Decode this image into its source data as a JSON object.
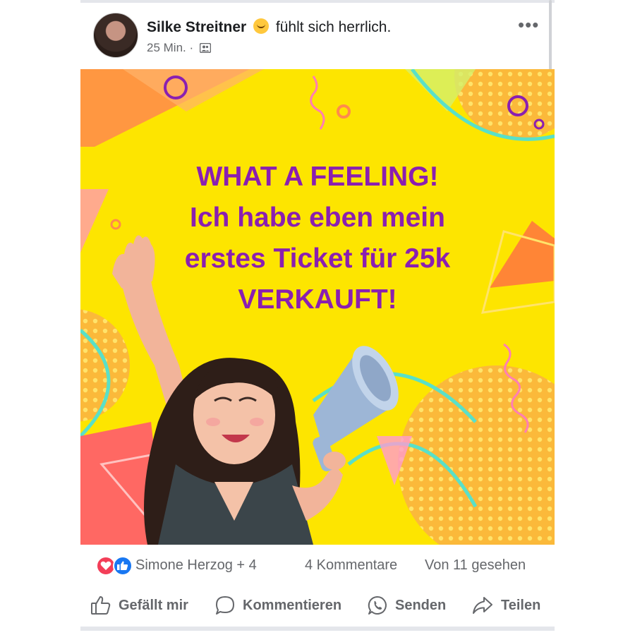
{
  "post": {
    "author": "Silke Streitner",
    "feeling": "fühlt sich herrlich.",
    "timestamp": "25 Min. ·",
    "audience_icon": "friends-icon",
    "more_icon": "•••",
    "image_text": {
      "line1": "WHAT A FEELING!",
      "line2": "Ich habe eben mein",
      "line3": "erstes Ticket für 25k",
      "line4": "VERKAUFT!"
    },
    "colors": {
      "image_background": "#fde500",
      "headline": "#8a1fb1",
      "like_blue": "#1877f2",
      "love_red": "#f33e58"
    }
  },
  "stats": {
    "reactors": "Simone Herzog + 4",
    "comments": "4 Kommentare",
    "views": "Von 11 gesehen"
  },
  "actions": {
    "like": "Gefällt mir",
    "comment": "Kommentieren",
    "send": "Senden",
    "share": "Teilen"
  }
}
